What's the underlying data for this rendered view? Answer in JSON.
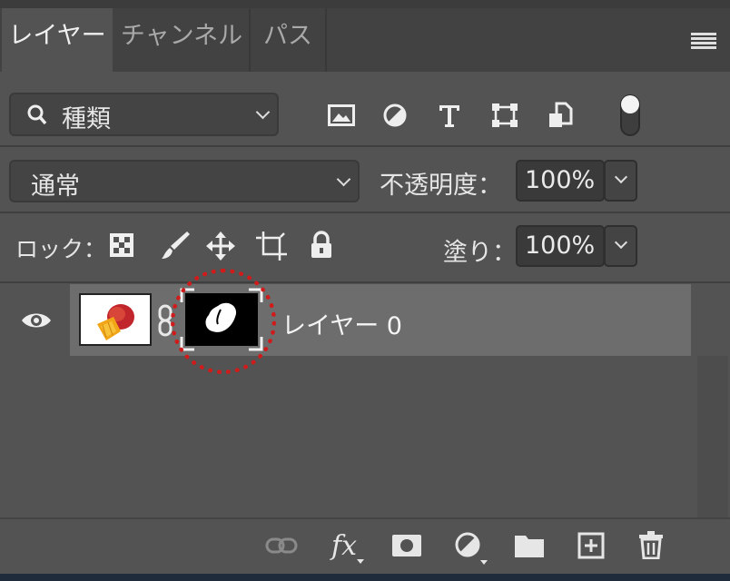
{
  "tabs": [
    {
      "label": "レイヤー",
      "active": true
    },
    {
      "label": "チャンネル",
      "active": false
    },
    {
      "label": "パス",
      "active": false
    }
  ],
  "filter": {
    "label": "種類"
  },
  "blend_mode": {
    "value": "通常"
  },
  "opacity": {
    "label": "不透明度：",
    "value": "100%"
  },
  "lock": {
    "label": "ロック："
  },
  "fill": {
    "label": "塗り：",
    "value": "100%"
  },
  "layer": {
    "name": "レイヤー 0"
  },
  "colors": {
    "panel": "#535353",
    "tab_inactive": "#424242",
    "layer_selected": "#6d6d6d",
    "highlight": "#d11a1a"
  },
  "icons": [
    "search-icon",
    "chevron-down-icon",
    "image-filter-icon",
    "adjustment-filter-icon",
    "type-filter-icon",
    "shape-filter-icon",
    "smart-object-filter-icon",
    "filter-toggle-icon",
    "lock-pixels-icon",
    "lock-image-icon",
    "lock-position-icon",
    "lock-artboard-icon",
    "lock-all-icon",
    "eye-icon",
    "link-icon",
    "fx-icon",
    "mask-icon",
    "adjustment-icon",
    "folder-icon",
    "new-layer-icon",
    "trash-icon",
    "menu-icon"
  ]
}
